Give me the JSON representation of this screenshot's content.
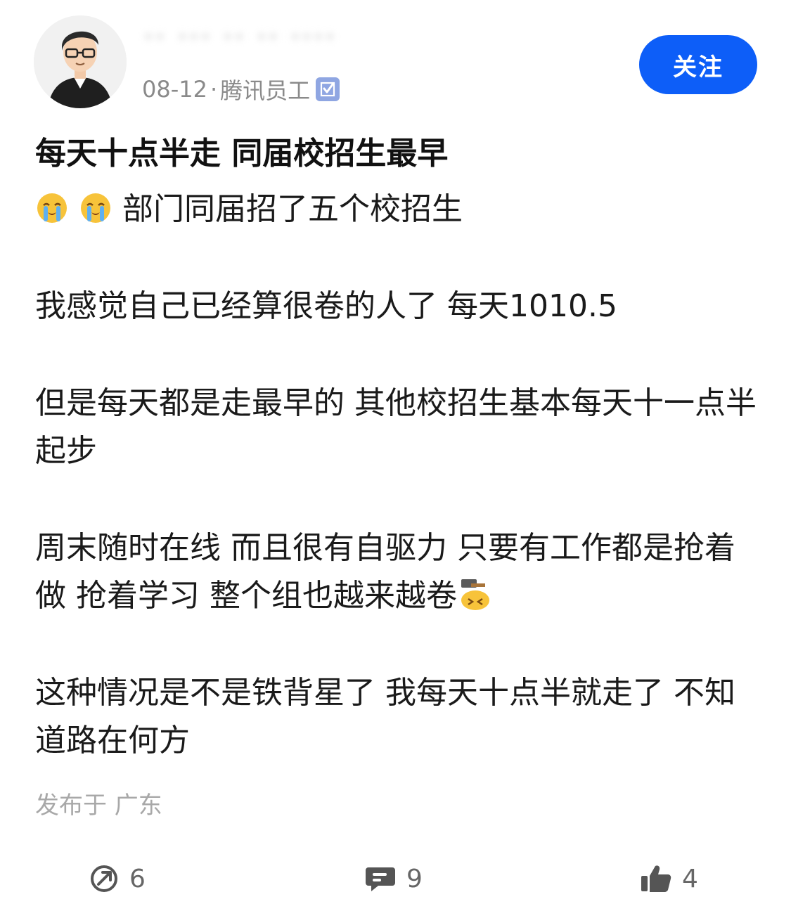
{
  "author": {
    "name": "·· ··· ·· ·· ····",
    "date": "08-12",
    "separator": "·",
    "company_tag": "腾讯员工",
    "verified_icon": "verified-check-icon"
  },
  "follow_button": {
    "label": "关注"
  },
  "post": {
    "title": "每天十点半走 同届校招生最早",
    "line1_emoji": [
      "crying-face-emoji",
      "crying-face-emoji"
    ],
    "line1_text": "部门同届招了五个校招生",
    "para2": "我感觉自己已经算很卷的人了 每天1010.5",
    "para3": "但是每天都是走最早的 其他校招生基本每天十一点半起步",
    "para4": "周末随时在线 而且很有自驱力 只要有工作都是抢着做 抢着学习 整个组也越来越卷",
    "para4_emoji": "hammer-hit-head-emoji",
    "para5": "这种情况是不是铁背星了 我每天十点半就走了 不知道路在何方"
  },
  "location": "发布于 广东",
  "actions": {
    "share": {
      "icon": "share-icon",
      "count": "6"
    },
    "comment": {
      "icon": "comment-icon",
      "count": "9"
    },
    "like": {
      "icon": "thumbs-up-icon",
      "count": "4"
    }
  },
  "colors": {
    "accent": "#0d5ef8",
    "meta_text": "#8a8a8a",
    "location_text": "#a8a8a8",
    "icon_gray": "#666666"
  }
}
